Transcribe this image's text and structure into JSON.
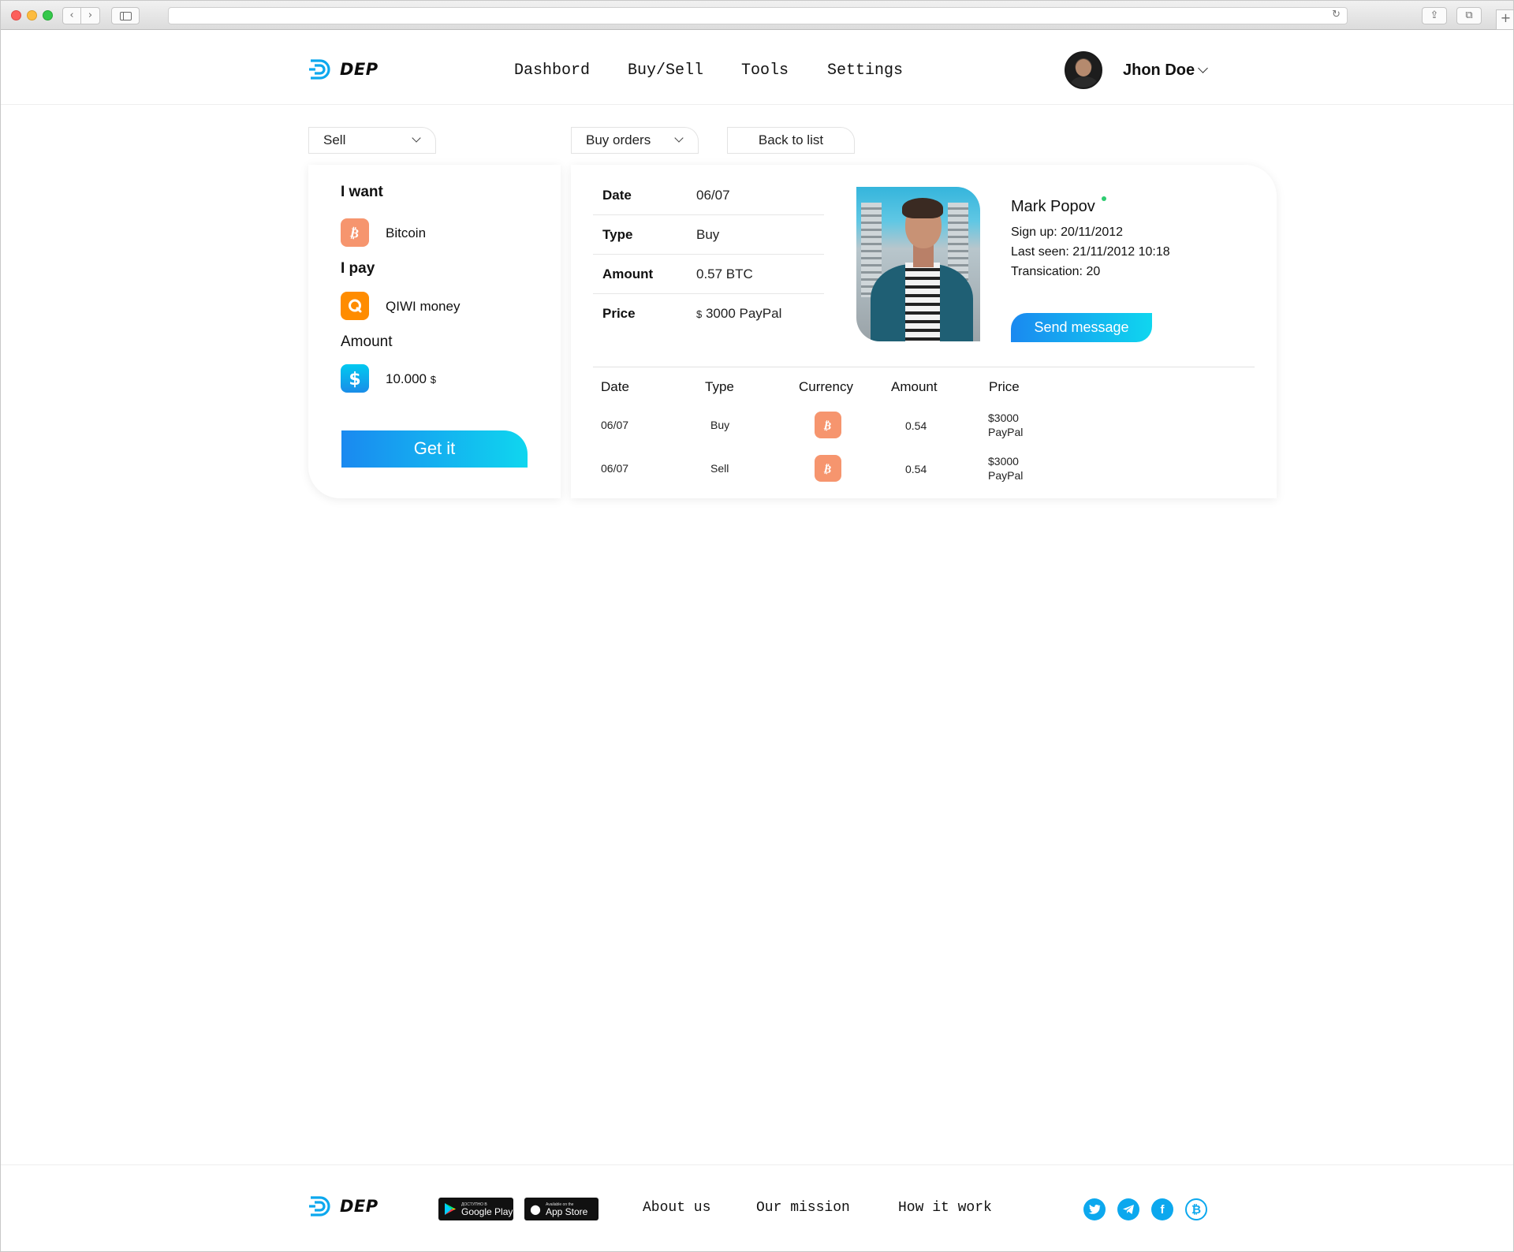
{
  "brand": {
    "name": "DEP",
    "accent": "#0ca8ee"
  },
  "nav": {
    "items": [
      "Dashbord",
      "Buy/Sell",
      "Tools",
      "Settings"
    ]
  },
  "user": {
    "name": "Jhon Doe"
  },
  "filters": {
    "mode": "Sell",
    "orders": "Buy orders",
    "back_label": "Back to list"
  },
  "trade_form": {
    "want_label": "I want",
    "want_value": "Bitcoin",
    "pay_label": "I pay",
    "pay_value": "QIWI money",
    "amount_label": "Amount",
    "amount_value": "10.000",
    "amount_currency": "$",
    "submit_label": "Get it"
  },
  "order": {
    "fields": [
      {
        "key": "Date",
        "value": "06/07"
      },
      {
        "key": "Type",
        "value": "Buy"
      },
      {
        "key": "Amount",
        "value": "0.57 BTC"
      },
      {
        "key": "Price",
        "value_prefix": "$",
        "value": "3000 PayPal"
      }
    ]
  },
  "trader": {
    "name": "Mark Popov",
    "status": "online",
    "signup": "Sign up: 20/11/2012",
    "last_seen": "Last seen: 21/11/2012 10:18",
    "transactions": "Transication: 20",
    "message_label": "Send message"
  },
  "history": {
    "columns": [
      "Date",
      "Type",
      "Currency",
      "Amount",
      "Price"
    ],
    "rows": [
      {
        "date": "06/07",
        "type": "Buy",
        "currency_icon": "bitcoin-icon",
        "amount": "0.54",
        "price_line1": "$3000",
        "price_line2": "PayPal"
      },
      {
        "date": "06/07",
        "type": "Sell",
        "currency_icon": "bitcoin-icon",
        "amount": "0.54",
        "price_line1": "$3000",
        "price_line2": "PayPal"
      }
    ]
  },
  "footer": {
    "google_small": "ДОСТУПНО В",
    "google_big": "Google Play",
    "apple_small": "Available on the",
    "apple_big": "App Store",
    "links": [
      "About us",
      "Our mission",
      "How it work"
    ],
    "social": [
      "twitter-icon",
      "telegram-icon",
      "facebook-icon",
      "bitcoin-icon"
    ]
  },
  "colors": {
    "bitcoin": "#f6956e",
    "qiwi": "#ff8c00",
    "gradient_start": "#1a89f0",
    "gradient_end": "#0fd6ef",
    "online": "#2ecc71"
  }
}
